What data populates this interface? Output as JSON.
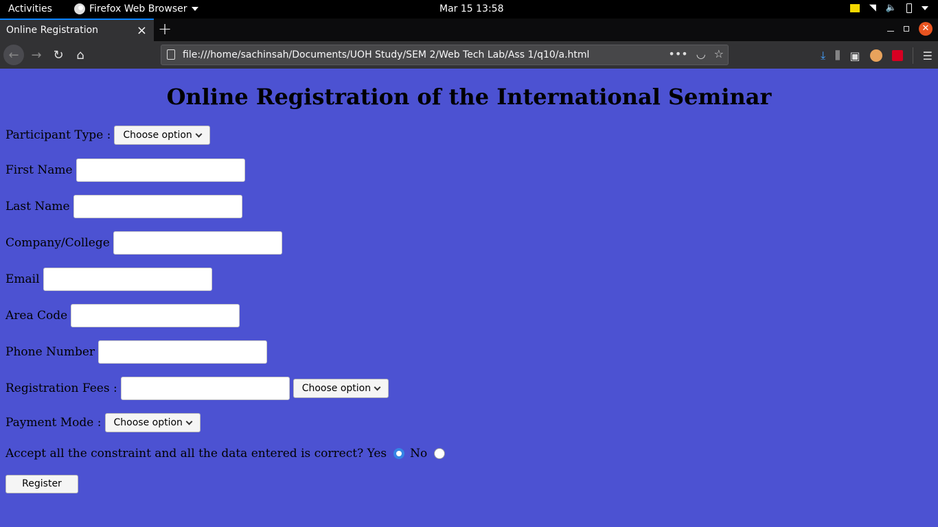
{
  "topbar": {
    "activities": "Activities",
    "app_name": "Firefox Web Browser",
    "clock": "Mar 15  13:58"
  },
  "tab": {
    "title": "Online Registration",
    "close": "×",
    "new_tab": "+"
  },
  "navbar": {
    "url": "file:///home/sachinsah/Documents/UOH Study/SEM 2/Web Tech Lab/Ass 1/q10/a.html",
    "page_actions": "•••"
  },
  "page": {
    "heading": "Online Registration of the International Seminar",
    "participant_type_label": "Participant Type :",
    "participant_type_select": "Choose option",
    "first_name_label": "First Name",
    "last_name_label": "Last Name",
    "company_label": "Company/College",
    "email_label": "Email",
    "area_code_label": "Area Code",
    "phone_label": "Phone Number",
    "fees_label": "Registration Fees :",
    "fees_select": "Choose option",
    "payment_mode_label": "Payment Mode :",
    "payment_mode_select": "Choose option",
    "accept_label": "Accept all the constraint and all the data entered is correct? Yes",
    "no_label": "No",
    "accept_selected": "Yes",
    "register_button": "Register"
  },
  "colors": {
    "page_background": "#4c52d2",
    "accent": "#0a84ff",
    "radio_checked": "#3584e4"
  }
}
